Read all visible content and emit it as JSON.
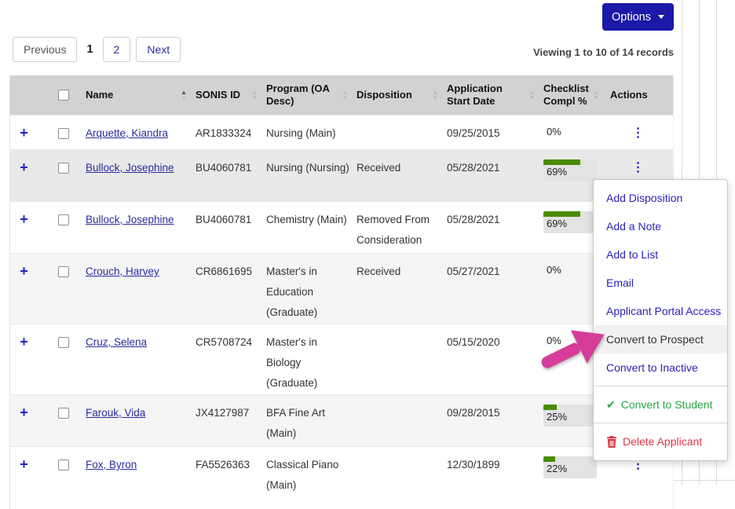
{
  "colors": {
    "accent_blue": "#1c18a8",
    "link_navy": "#2b2b9e",
    "menu_link_navy": "#2e22b8",
    "success_green": "#28a745",
    "danger_red": "#dc3545",
    "annotation_pink": "#d53d99",
    "progress_bar_green": "#4a8c00",
    "header_gray": "#d2d2d2"
  },
  "icons": {
    "expand_glyph": "+",
    "actions_glyph": "⋮",
    "sort_up": "▲",
    "sort_down": "▼",
    "check_glyph": "✔"
  },
  "toolbar": {
    "options_label": "Options"
  },
  "pagination": {
    "previous_label": "Previous",
    "current_page": "1",
    "page2_label": "2",
    "next_label": "Next",
    "viewing_text": "Viewing 1 to 10 of 14 records"
  },
  "table": {
    "sorted_by": "Name",
    "sort_direction": "asc",
    "headers": {
      "name": "Name",
      "sonis_id": "SONIS ID",
      "program": "Program (OA Desc)",
      "disposition": "Disposition",
      "start_date": "Application Start Date",
      "checklist": "Checklist Compl %",
      "actions": "Actions"
    },
    "rows": [
      {
        "name": "Arquette, Kiandra",
        "sonis_id": "AR1833324",
        "program": "Nursing (Main)",
        "disposition": "",
        "start_date": "09/25/2015",
        "checklist_pct": "0%",
        "checklist_value": 0,
        "active": false
      },
      {
        "name": "Bullock, Josephine",
        "sonis_id": "BU4060781",
        "program": "Nursing (Nursing)",
        "disposition": "Received",
        "start_date": "05/28/2021",
        "checklist_pct": "69%",
        "checklist_value": 69,
        "active": true
      },
      {
        "name": "Bullock, Josephine",
        "sonis_id": "BU4060781",
        "program": "Chemistry (Main)",
        "disposition": "Removed From Consideration",
        "start_date": "05/28/2021",
        "checklist_pct": "69%",
        "checklist_value": 69,
        "active": false
      },
      {
        "name": "Crouch, Harvey",
        "sonis_id": "CR6861695",
        "program": "Master's in Education (Graduate)",
        "disposition": "Received",
        "start_date": "05/27/2021",
        "checklist_pct": "0%",
        "checklist_value": 0,
        "active": false
      },
      {
        "name": "Cruz, Selena",
        "sonis_id": "CR5708724",
        "program": "Master's in Biology (Graduate)",
        "disposition": "",
        "start_date": "05/15/2020",
        "checklist_pct": "0%",
        "checklist_value": 0,
        "active": false
      },
      {
        "name": "Farouk, Vida",
        "sonis_id": "JX4127987",
        "program": "BFA Fine Art (Main)",
        "disposition": "",
        "start_date": "09/28/2015",
        "checklist_pct": "25%",
        "checklist_value": 25,
        "active": false
      },
      {
        "name": "Fox, Byron",
        "sonis_id": "FA5526363",
        "program": "Classical Piano (Main)",
        "disposition": "",
        "start_date": "12/30/1899",
        "checklist_pct": "22%",
        "checklist_value": 22,
        "active": false
      }
    ]
  },
  "actions_menu": {
    "items": [
      {
        "label": "Add Disposition",
        "type": "link",
        "icon": null,
        "divider_before": false
      },
      {
        "label": "Add a Note",
        "type": "link",
        "icon": null,
        "divider_before": false
      },
      {
        "label": "Add to List",
        "type": "link",
        "icon": null,
        "divider_before": false
      },
      {
        "label": "Email",
        "type": "link",
        "icon": null,
        "divider_before": false
      },
      {
        "label": "Applicant Portal Access",
        "type": "link",
        "icon": null,
        "divider_before": false
      },
      {
        "label": "Convert to Prospect",
        "type": "highlighted",
        "icon": null,
        "divider_before": false
      },
      {
        "label": "Convert to Inactive",
        "type": "link",
        "icon": null,
        "divider_before": false
      },
      {
        "label": "Convert to Student",
        "type": "success",
        "icon": "check-icon",
        "divider_before": true
      },
      {
        "label": "Delete Applicant",
        "type": "danger",
        "icon": "trash-icon",
        "divider_before": true
      }
    ]
  }
}
